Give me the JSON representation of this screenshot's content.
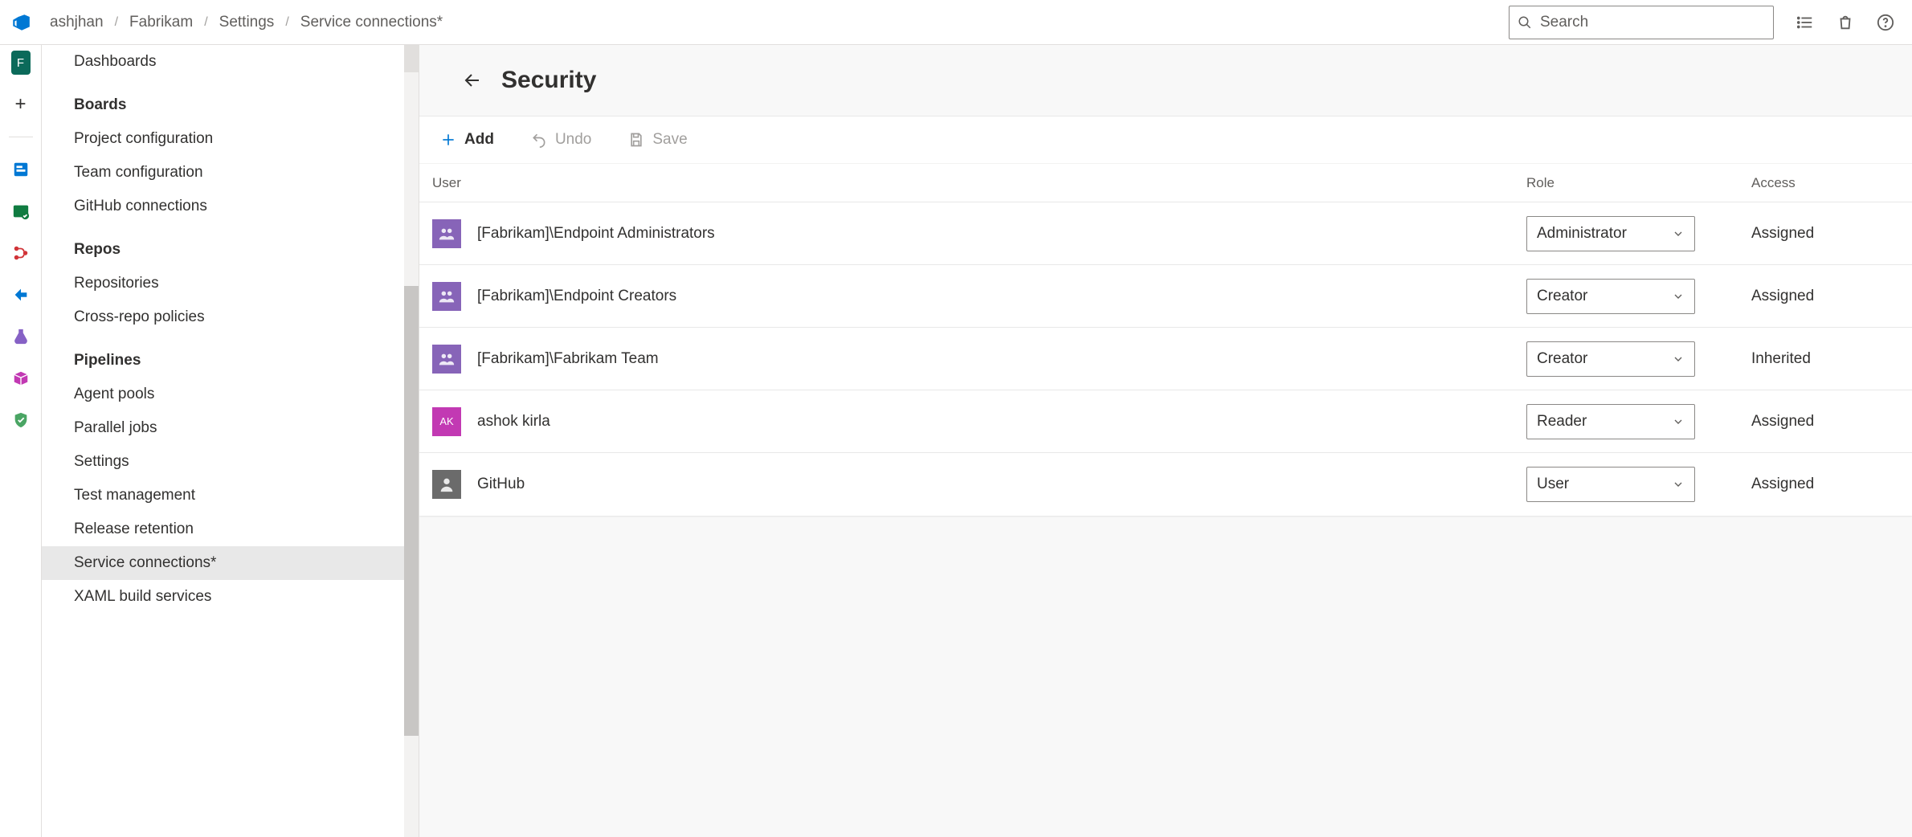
{
  "breadcrumb": {
    "org": "ashjhan",
    "project": "Fabrikam",
    "section": "Settings",
    "page": "Service connections*"
  },
  "search": {
    "placeholder": "Search"
  },
  "rail": {
    "project_initial": "F"
  },
  "sidebar": {
    "groups": [
      {
        "header": null,
        "items": [
          "Dashboards"
        ]
      },
      {
        "header": "Boards",
        "items": [
          "Project configuration",
          "Team configuration",
          "GitHub connections"
        ]
      },
      {
        "header": "Repos",
        "items": [
          "Repositories",
          "Cross-repo policies"
        ]
      },
      {
        "header": "Pipelines",
        "items": [
          "Agent pools",
          "Parallel jobs",
          "Settings",
          "Test management",
          "Release retention",
          "Service connections*",
          "XAML build services"
        ]
      }
    ],
    "selected": "Service connections*"
  },
  "main": {
    "title": "Security",
    "toolbar": {
      "add": "Add",
      "undo": "Undo",
      "save": "Save"
    },
    "columns": {
      "user": "User",
      "role": "Role",
      "access": "Access"
    },
    "rows": [
      {
        "name": "[Fabrikam]\\Endpoint Administrators",
        "role": "Administrator",
        "access": "Assigned",
        "avatar": "group"
      },
      {
        "name": "[Fabrikam]\\Endpoint Creators",
        "role": "Creator",
        "access": "Assigned",
        "avatar": "group"
      },
      {
        "name": "[Fabrikam]\\Fabrikam Team",
        "role": "Creator",
        "access": "Inherited",
        "avatar": "group"
      },
      {
        "name": "ashok kirla",
        "role": "Reader",
        "access": "Assigned",
        "avatar": "user",
        "initials": "AK"
      },
      {
        "name": "GitHub",
        "role": "User",
        "access": "Assigned",
        "avatar": "svc"
      }
    ]
  }
}
